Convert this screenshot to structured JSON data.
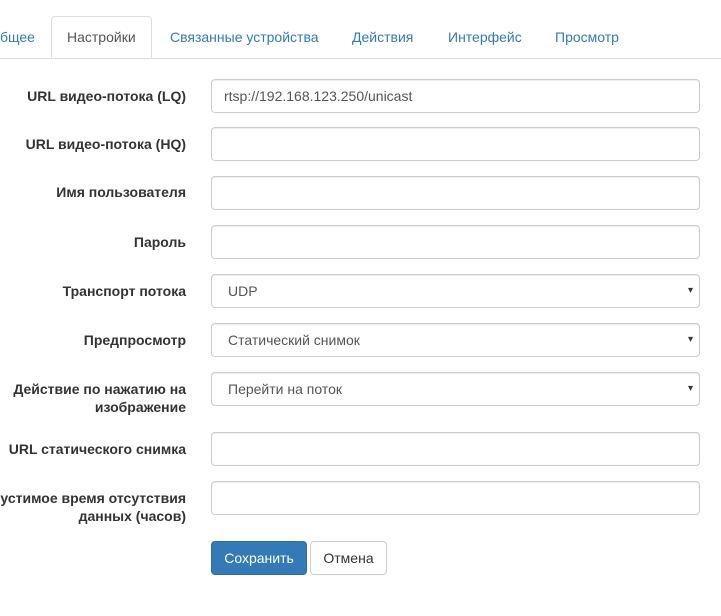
{
  "tabs": [
    {
      "label": "бщее",
      "active": false
    },
    {
      "label": "Настройки",
      "active": true
    },
    {
      "label": "Связанные устройства",
      "active": false
    },
    {
      "label": "Действия",
      "active": false
    },
    {
      "label": "Интерфейс",
      "active": false
    },
    {
      "label": "Просмотр",
      "active": false
    }
  ],
  "form": {
    "stream_url_lq": {
      "label": "URL видео-потока (LQ)",
      "value": "rtsp://192.168.123.250/unicast"
    },
    "stream_url_hq": {
      "label": "URL видео-потока (HQ)",
      "value": ""
    },
    "username": {
      "label": "Имя пользователя",
      "value": ""
    },
    "password": {
      "label": "Пароль",
      "value": ""
    },
    "stream_transport": {
      "label": "Транспорт потока",
      "selected": "UDP"
    },
    "preview": {
      "label": "Предпросмотр",
      "selected": "Статический снимок"
    },
    "click_action": {
      "label_line1": "Действие по нажатию на",
      "label_line2": "изображение",
      "selected": "Перейти на поток"
    },
    "snapshot_url": {
      "label": "URL статического снимка",
      "value": ""
    },
    "data_timeout": {
      "label_line1": "устимое время отсутствия",
      "label_line2": "данных (часов)",
      "value": ""
    }
  },
  "buttons": {
    "save": "Сохранить",
    "cancel": "Отмена"
  },
  "icons": {
    "select_caret": "▾"
  },
  "colors": {
    "link": "#337ab7",
    "primary": "#337ab7",
    "border": "#cccccc"
  }
}
